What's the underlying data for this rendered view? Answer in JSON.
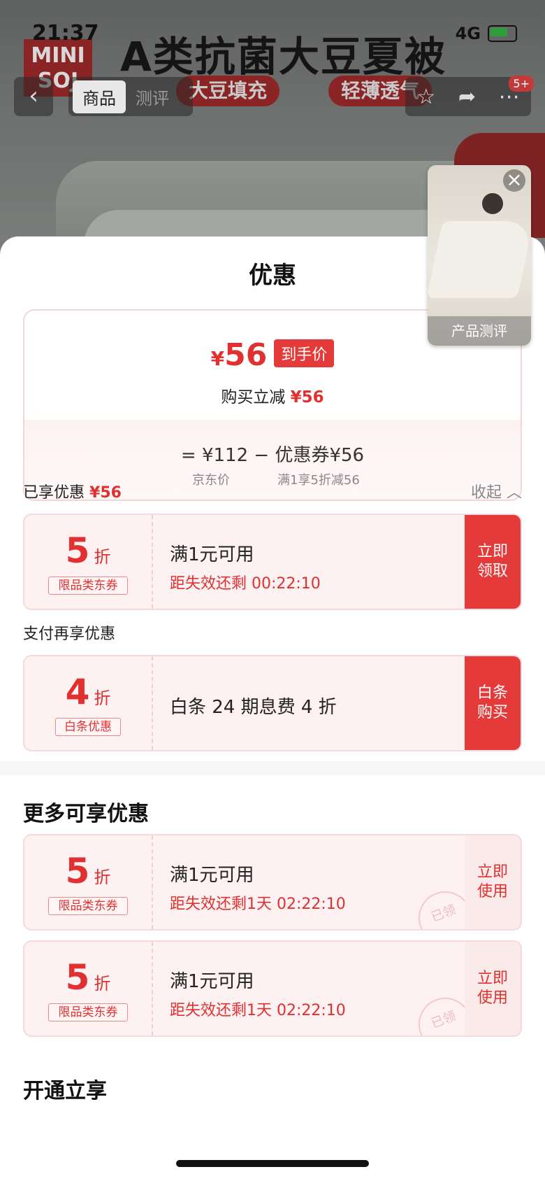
{
  "status_bar": {
    "time": "21:37",
    "network": "4G"
  },
  "background": {
    "brand_logo": "MINI SOJ",
    "headline": "A类抗菌大豆夏被",
    "tags": [
      "大豆填充",
      "轻薄透气"
    ],
    "nav": {
      "tabs": [
        "商品",
        "测评"
      ],
      "active_tab": "商品",
      "badge": "5+"
    }
  },
  "video": {
    "label": "产品测评"
  },
  "sheet": {
    "title": "优惠",
    "summary": {
      "currency": "¥",
      "price": "56",
      "price_tag": "到手价",
      "discount_text": "购买立减",
      "discount_amount": "¥56",
      "formula": "=  ¥112  −  优惠券¥56",
      "formula_label_1": "京东价",
      "formula_label_2": "满1享5折减56"
    },
    "enjoyed": {
      "label": "已享优惠",
      "amount": "¥56",
      "collapse": "收起"
    },
    "coupon_enjoyed": {
      "rate": "5",
      "unit": "折",
      "type": "限品类东券",
      "condition": "满1元可用",
      "countdown": "距失效还剩 00:22:10",
      "action": "立即\n领取"
    },
    "pay_section_label": "支付再享优惠",
    "coupon_pay": {
      "rate": "4",
      "unit": "折",
      "type": "白条优惠",
      "desc": "白条 24 期息费 4 折",
      "action": "白条\n购买"
    },
    "more_heading": "更多可享优惠",
    "more_coupons": [
      {
        "rate": "5",
        "unit": "折",
        "type": "限品类东券",
        "condition": "满1元可用",
        "countdown": "距失效还剩1天 02:22:10",
        "action": "立即\n使用",
        "stamp": "已领"
      },
      {
        "rate": "5",
        "unit": "折",
        "type": "限品类东券",
        "condition": "满1元可用",
        "countdown": "距失效还剩1天 02:22:10",
        "action": "立即\n使用",
        "stamp": "已领"
      }
    ],
    "open_heading": "开通立享"
  },
  "colors": {
    "accent": "#e53a3a",
    "coupon_bg": "#fdf1f1"
  }
}
